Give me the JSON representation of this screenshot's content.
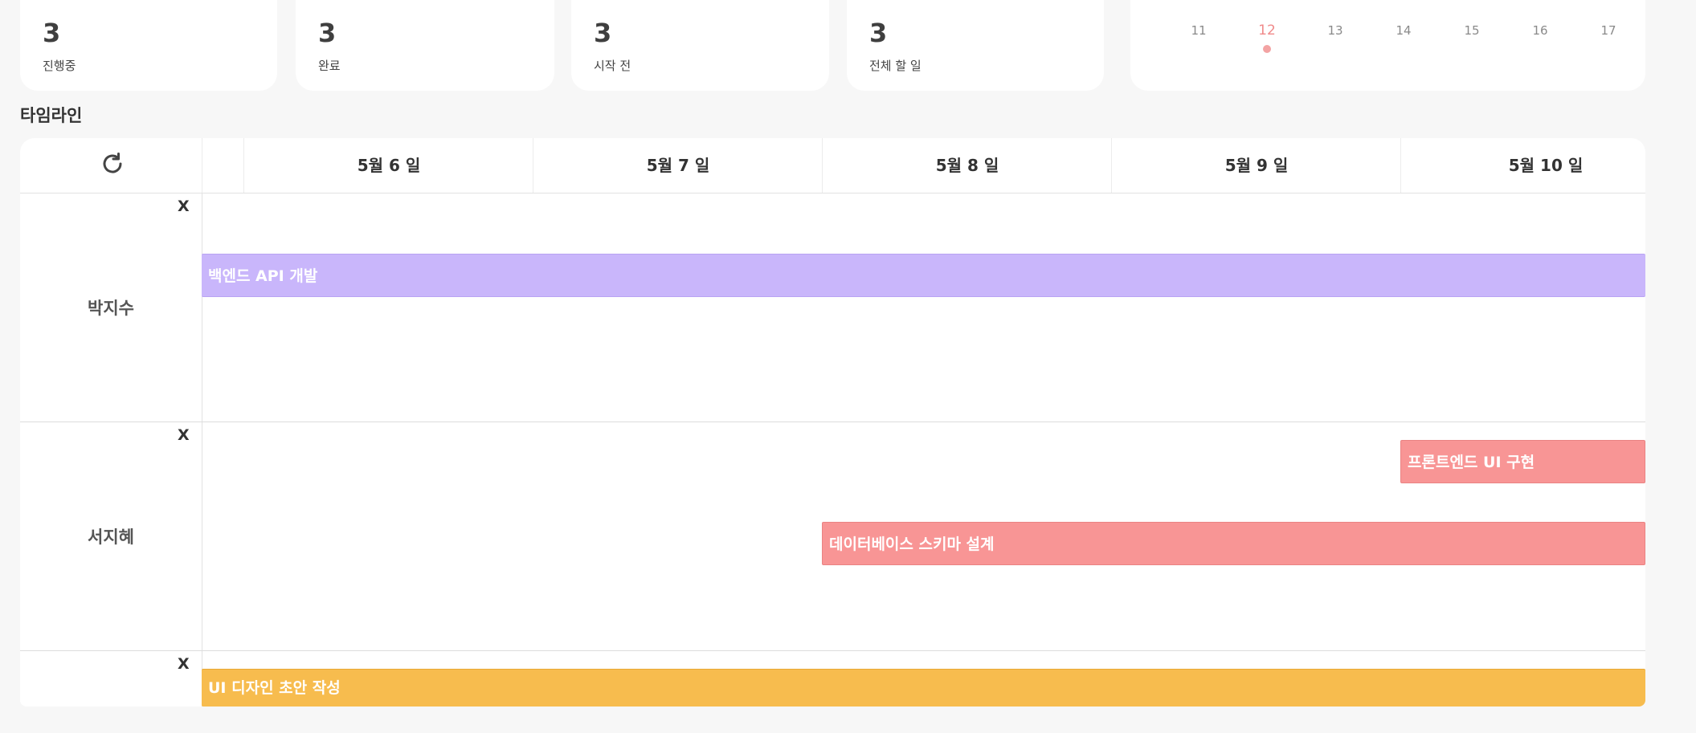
{
  "stats": [
    {
      "count": "3",
      "label": "진행중"
    },
    {
      "count": "3",
      "label": "완료"
    },
    {
      "count": "3",
      "label": "시작 전"
    },
    {
      "count": "3",
      "label": "전체 할 일"
    }
  ],
  "calendar": {
    "days": [
      "11",
      "12",
      "13",
      "14",
      "15",
      "16",
      "17"
    ],
    "today": "12",
    "accent_color": "#f08a8a"
  },
  "timeline": {
    "title": "타임라인",
    "refresh_icon": "refresh-icon",
    "dates": [
      "5월 6 일",
      "5월 7 일",
      "5월 8 일",
      "5월 9 일",
      "5월 10 일"
    ],
    "close_label": "X",
    "rows": [
      {
        "name": "박지수",
        "tasks": [
          {
            "label": "백엔드 API 개발",
            "color": "#c9b6fb"
          }
        ]
      },
      {
        "name": "서지혜",
        "tasks": [
          {
            "label": "프론트엔드 UI 구현",
            "color": "#f89595"
          },
          {
            "label": "데이터베이스 스키마 설계",
            "color": "#f89595"
          }
        ]
      },
      {
        "name": "",
        "tasks": [
          {
            "label": "UI 디자인 초안 작성",
            "color": "#f7bc4e"
          }
        ]
      }
    ]
  }
}
